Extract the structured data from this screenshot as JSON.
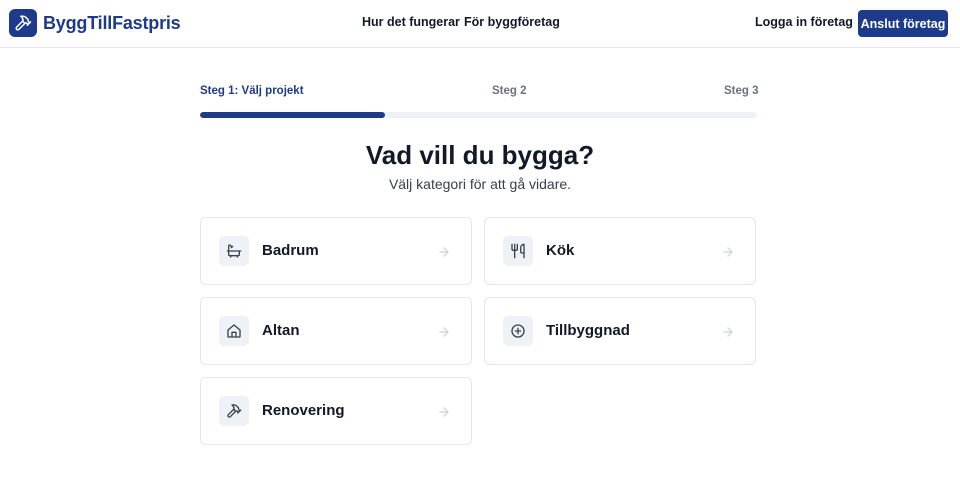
{
  "header": {
    "brand": "ByggTillFastpris",
    "nav": [
      "Hur det fungerar",
      "För byggföretag"
    ],
    "login": "Logga in företag",
    "signup": "Anslut företag"
  },
  "steps": {
    "items": [
      "Steg 1: Välj projekt",
      "Steg 2",
      "Steg 3"
    ],
    "active_index": 0,
    "progress_fraction": 0.333
  },
  "main": {
    "title": "Vad vill du bygga?",
    "subtitle": "Välj kategori för att gå vidare."
  },
  "categories": [
    {
      "label": "Badrum",
      "icon": "bathtub-icon"
    },
    {
      "label": "Kök",
      "icon": "utensils-icon"
    },
    {
      "label": "Altan",
      "icon": "house-icon"
    },
    {
      "label": "Tillbyggnad",
      "icon": "plus-circle-icon"
    },
    {
      "label": "Renovering",
      "icon": "hammer-icon"
    }
  ],
  "colors": {
    "brand": "#1e3a8a",
    "muted": "#6b7280",
    "icon_bg": "#eef2f7",
    "arrow": "#c7d2e0"
  }
}
